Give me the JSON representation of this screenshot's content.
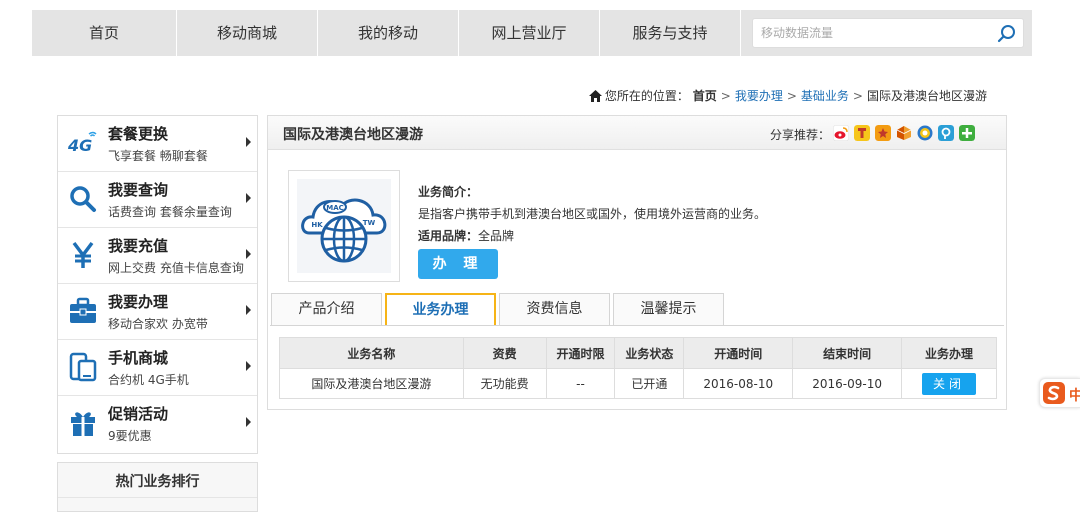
{
  "topnav": {
    "items": [
      "首页",
      "移动商城",
      "我的移动",
      "网上营业厅",
      "服务与支持"
    ],
    "search_placeholder": "移动数据流量"
  },
  "breadcrumb": {
    "prefix": "您所在的位置：",
    "items": [
      "首页",
      "我要办理",
      "基础业务",
      "国际及港澳台地区漫游"
    ],
    "separator": ">"
  },
  "left_menu": {
    "items": [
      {
        "title": "套餐更换",
        "sub": "飞享套餐 畅聊套餐",
        "icon": "4g-icon"
      },
      {
        "title": "我要查询",
        "sub": "话费查询 套餐余量查询",
        "icon": "search-icon"
      },
      {
        "title": "我要充值",
        "sub": "网上交费 充值卡信息查询",
        "icon": "yen-icon"
      },
      {
        "title": "我要办理",
        "sub": "移动合家欢 办宽带",
        "icon": "briefcase-icon"
      },
      {
        "title": "手机商城",
        "sub": "合约机 4G手机",
        "icon": "phone-icon"
      },
      {
        "title": "促销活动",
        "sub": "9要优惠",
        "icon": "gift-icon"
      }
    ],
    "logo_text_4g": "4G"
  },
  "hot": {
    "title": "热门业务排行"
  },
  "panel": {
    "title": "国际及港澳台地区漫游",
    "share_label": "分享推荐：",
    "share_icons": [
      "weibo-icon",
      "tencent-icon",
      "qzone-icon",
      "kaixin-icon",
      "renren-icon",
      "douban-icon",
      "more-share-icon"
    ],
    "image_labels": {
      "mac": "MAC",
      "hk": "HK",
      "tw": "TW"
    },
    "desc_label": "业务简介：",
    "desc_text": "是指客户携带手机到港澳台地区或国外，使用境外运营商的业务。",
    "brand_label": "适用品牌：",
    "brand_value": "全品牌",
    "apply_label": "办 理"
  },
  "tabs": [
    {
      "label": "产品介绍",
      "active": false
    },
    {
      "label": "业务办理",
      "active": true
    },
    {
      "label": "资费信息",
      "active": false
    },
    {
      "label": "温馨提示",
      "active": false
    }
  ],
  "table": {
    "headers": [
      "业务名称",
      "资费",
      "开通时限",
      "业务状态",
      "开通时间",
      "结束时间",
      "业务办理"
    ],
    "rows": [
      [
        "国际及港澳台地区漫游",
        "无功能费",
        "--",
        "已开通",
        "2016-08-10",
        "2016-09-10",
        "关闭"
      ]
    ]
  },
  "float_widget": {
    "text": "中"
  },
  "colors": {
    "accent": "#31a9ec",
    "tab_active_border": "#f6b417",
    "link": "#1e6fb5",
    "nav_bg": "#e4e4e4"
  }
}
